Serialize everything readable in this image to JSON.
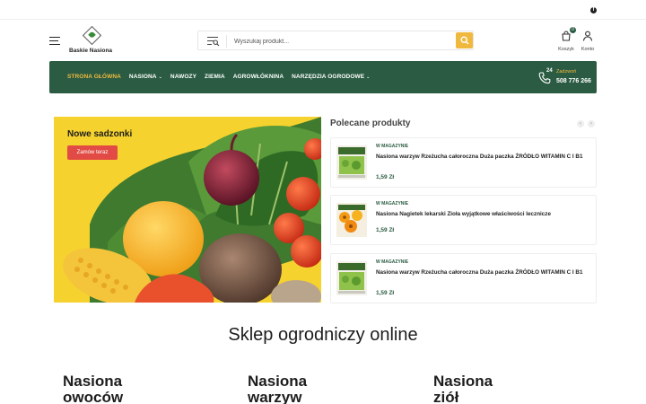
{
  "header": {
    "logo_text": "Baskie Nasiona",
    "search_placeholder": "Wyszukaj produkt...",
    "cart_label": "Koszyk",
    "cart_count": "0",
    "account_label": "Konto"
  },
  "nav": {
    "items": [
      {
        "label": "STRONA GŁÓWNA",
        "active": true,
        "dropdown": false
      },
      {
        "label": "NASIONA",
        "active": false,
        "dropdown": true
      },
      {
        "label": "NAWOZY",
        "active": false,
        "dropdown": false
      },
      {
        "label": "ZIEMIA",
        "active": false,
        "dropdown": false
      },
      {
        "label": "AGROWŁÓKNINA",
        "active": false,
        "dropdown": false
      },
      {
        "label": "NARZĘDZIA OGRODOWE",
        "active": false,
        "dropdown": true
      }
    ],
    "call_24": "24",
    "call_label": "Zadzwoń",
    "call_number": "508 776 266"
  },
  "banner": {
    "title": "Nowe sadzonki",
    "button": "Zamów teraz"
  },
  "recommended": {
    "title": "Polecane produkty",
    "prev": "‹",
    "next": "›",
    "items": [
      {
        "stock": "W MAGAZYNIE",
        "name": "Nasiona warzyw Rzeżucha całoroczna Duża paczka ŻRÓDŁO WITAMIN C I B1",
        "price": "1,59 Zł"
      },
      {
        "stock": "W MAGAZYNIE",
        "name": "Nasiona Nagietek lekarski Zioła wyjątkowe właściwości lecznicze",
        "price": "1,59 Zł"
      },
      {
        "stock": "W MAGAZYNIE",
        "name": "Nasiona warzyw Rzeżucha całoroczna Duża paczka ŻRÓDŁO WITAMIN C I B1",
        "price": "1,59 Zł"
      }
    ]
  },
  "section": {
    "title": "Sklep ogrodniczy online",
    "categories": [
      {
        "line1": "Nasiona",
        "line2": "owoców"
      },
      {
        "line1": "Nasiona",
        "line2": "warzyw"
      },
      {
        "line1": "Nasiona",
        "line2": "ziół"
      }
    ]
  },
  "colors": {
    "brand_green": "#2b5c43",
    "accent_yellow": "#f0b93e",
    "cta_red": "#e24b45"
  },
  "icons": [
    "facebook-icon",
    "hamburger-icon",
    "filter-icon",
    "search-icon",
    "cart-icon",
    "user-icon",
    "phone-icon",
    "chevron-left-icon",
    "chevron-right-icon"
  ]
}
